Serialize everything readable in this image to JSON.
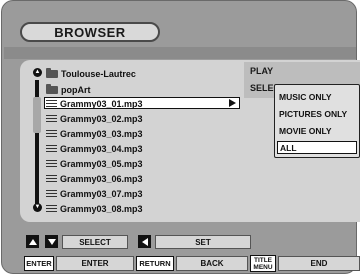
{
  "window": {
    "title": "BROWSER"
  },
  "right_panel": {
    "item1": "PLAY",
    "item2": "SELECT FILES"
  },
  "browser_list": {
    "items": [
      {
        "type": "folder",
        "label": "Toulouse-Lautrec"
      },
      {
        "type": "folder",
        "label": "popArt"
      },
      {
        "type": "file",
        "label": "Grammy03_01.mp3",
        "selected": true
      },
      {
        "type": "file",
        "label": "Grammy03_02.mp3"
      },
      {
        "type": "file",
        "label": "Grammy03_03.mp3"
      },
      {
        "type": "file",
        "label": "Grammy03_04.mp3"
      },
      {
        "type": "file",
        "label": "Grammy03_05.mp3"
      },
      {
        "type": "file",
        "label": "Grammy03_06.mp3"
      },
      {
        "type": "file",
        "label": "Grammy03_07.mp3"
      },
      {
        "type": "file",
        "label": "Grammy03_08.mp3"
      }
    ]
  },
  "filter_menu": {
    "options": [
      "MUSIC ONLY",
      "PICTURES ONLY",
      "MOVIE ONLY",
      "ALL"
    ],
    "selected": "ALL"
  },
  "controls": {
    "row1": {
      "select_label": "SELECT",
      "set_label": "SET"
    },
    "row2": {
      "enter_key": "ENTER",
      "enter_label": "ENTER",
      "return_key": "RETURN",
      "back_label": "BACK",
      "title_menu_key_line1": "TITLE",
      "title_menu_key_line2": "MENU",
      "end_label": "END"
    }
  }
}
